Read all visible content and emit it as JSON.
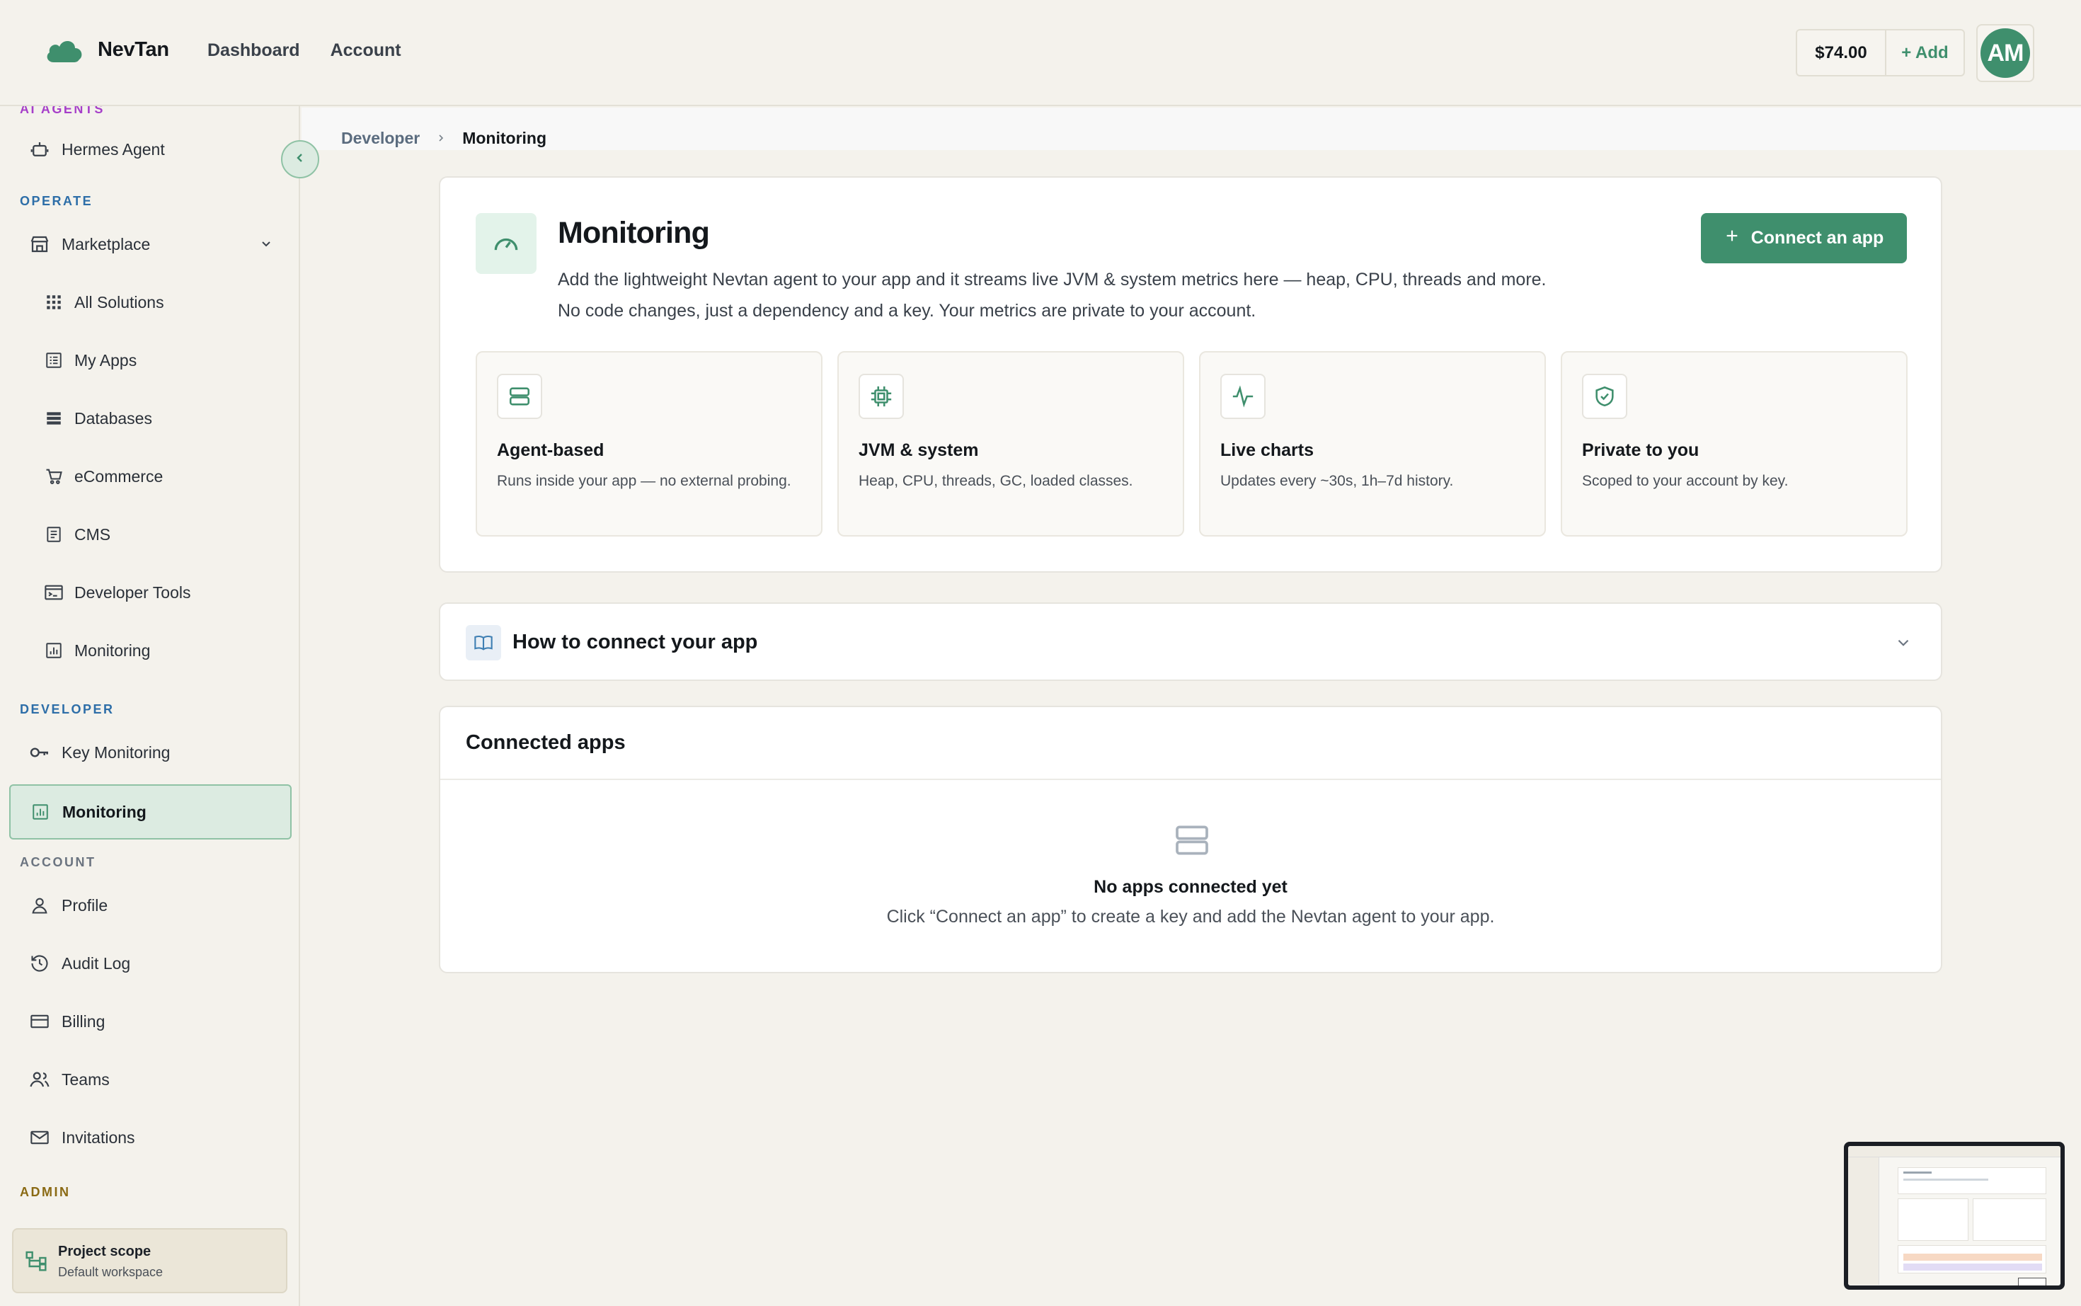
{
  "app": {
    "name": "NevTan",
    "nav": [
      "Dashboard",
      "Account"
    ],
    "balance": "$74.00",
    "add_label": "+ Add",
    "avatar_initials": "AM",
    "accent_color": "#3f8f6d"
  },
  "sidebar": {
    "sections": {
      "ai_agents": "AI AGENTS",
      "operate": "OPERATE",
      "developer": "DEVELOPER",
      "account": "ACCOUNT",
      "admin": "ADMIN"
    },
    "items": {
      "hermes_agent": "Hermes Agent",
      "marketplace": "Marketplace",
      "all_solutions": "All Solutions",
      "my_apps": "My Apps",
      "databases": "Databases",
      "ecommerce": "eCommerce",
      "cms": "CMS",
      "developer_tools": "Developer Tools",
      "monitoring_sub": "Monitoring",
      "key_monitoring": "Key Monitoring",
      "monitoring": "Monitoring",
      "profile": "Profile",
      "audit_log": "Audit Log",
      "billing": "Billing",
      "teams": "Teams",
      "invitations": "Invitations"
    },
    "active_item": "monitoring",
    "project_scope": {
      "title": "Project scope",
      "subtitle": "Default workspace"
    }
  },
  "breadcrumb": [
    "Developer",
    "Monitoring"
  ],
  "hero": {
    "title": "Monitoring",
    "description": "Add the lightweight Nevtan agent to your app and it streams live JVM & system metrics here — heap, CPU, threads and more. No code changes, just a dependency and a key. Your metrics are private to your account.",
    "connect_button": "Connect an app",
    "features": [
      {
        "icon": "server-icon",
        "title": "Agent-based",
        "desc": "Runs inside your app — no external probing."
      },
      {
        "icon": "cpu-icon",
        "title": "JVM & system",
        "desc": "Heap, CPU, threads, GC, loaded classes."
      },
      {
        "icon": "activity-icon",
        "title": "Live charts",
        "desc": "Updates every ~30s, 1h–7d history."
      },
      {
        "icon": "shield-check-icon",
        "title": "Private to you",
        "desc": "Scoped to your account by key."
      }
    ]
  },
  "howto": {
    "title": "How to connect your app"
  },
  "connected_apps": {
    "title": "Connected apps",
    "empty_title": "No apps connected yet",
    "empty_hint": "Click “Connect an app” to create a key and add the Nevtan agent to your app."
  }
}
